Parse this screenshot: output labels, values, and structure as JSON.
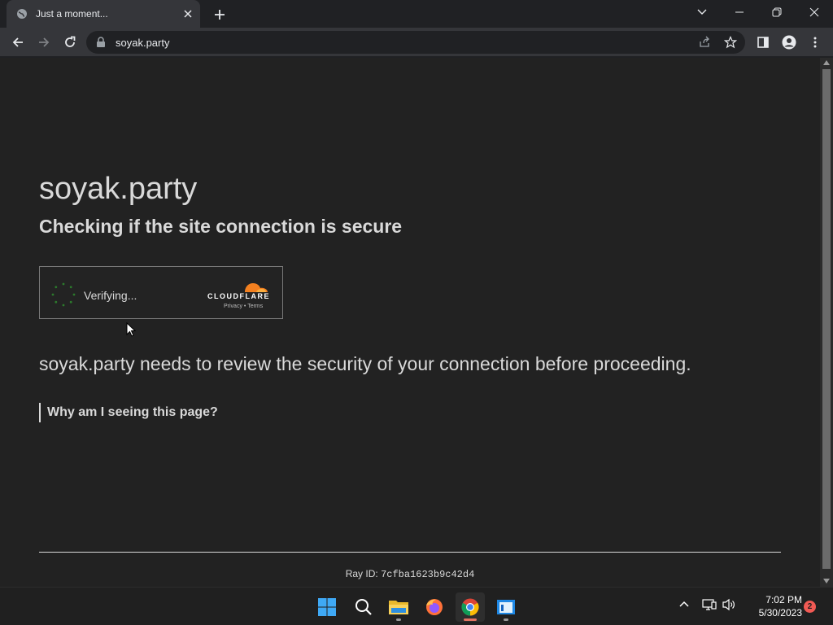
{
  "browser": {
    "tab_title": "Just a moment...",
    "url": "soyak.party"
  },
  "page": {
    "site_title": "soyak.party",
    "subtitle": "Checking if the site connection is secure",
    "widget": {
      "status": "Verifying...",
      "brand": "CLOUDFLARE",
      "privacy": "Privacy",
      "separator": "•",
      "terms": "Terms"
    },
    "review_text": "soyak.party needs to review the security of your connection before proceeding.",
    "why_link": "Why am I seeing this page?",
    "ray_label": "Ray ID:",
    "ray_id": "7cfba1623b9c42d4"
  },
  "taskbar": {
    "time": "7:02 PM",
    "date": "5/30/2023",
    "notification_count": "2",
    "apps": [
      "start-icon",
      "search-icon",
      "file-explorer-icon",
      "firefox-icon",
      "chrome-icon",
      "notepad-icon"
    ]
  },
  "colors": {
    "cloudflare_orange": "#f38020",
    "spinner_green": "#2c7a2c",
    "page_bg": "#222222",
    "text": "#d9d9d9"
  }
}
